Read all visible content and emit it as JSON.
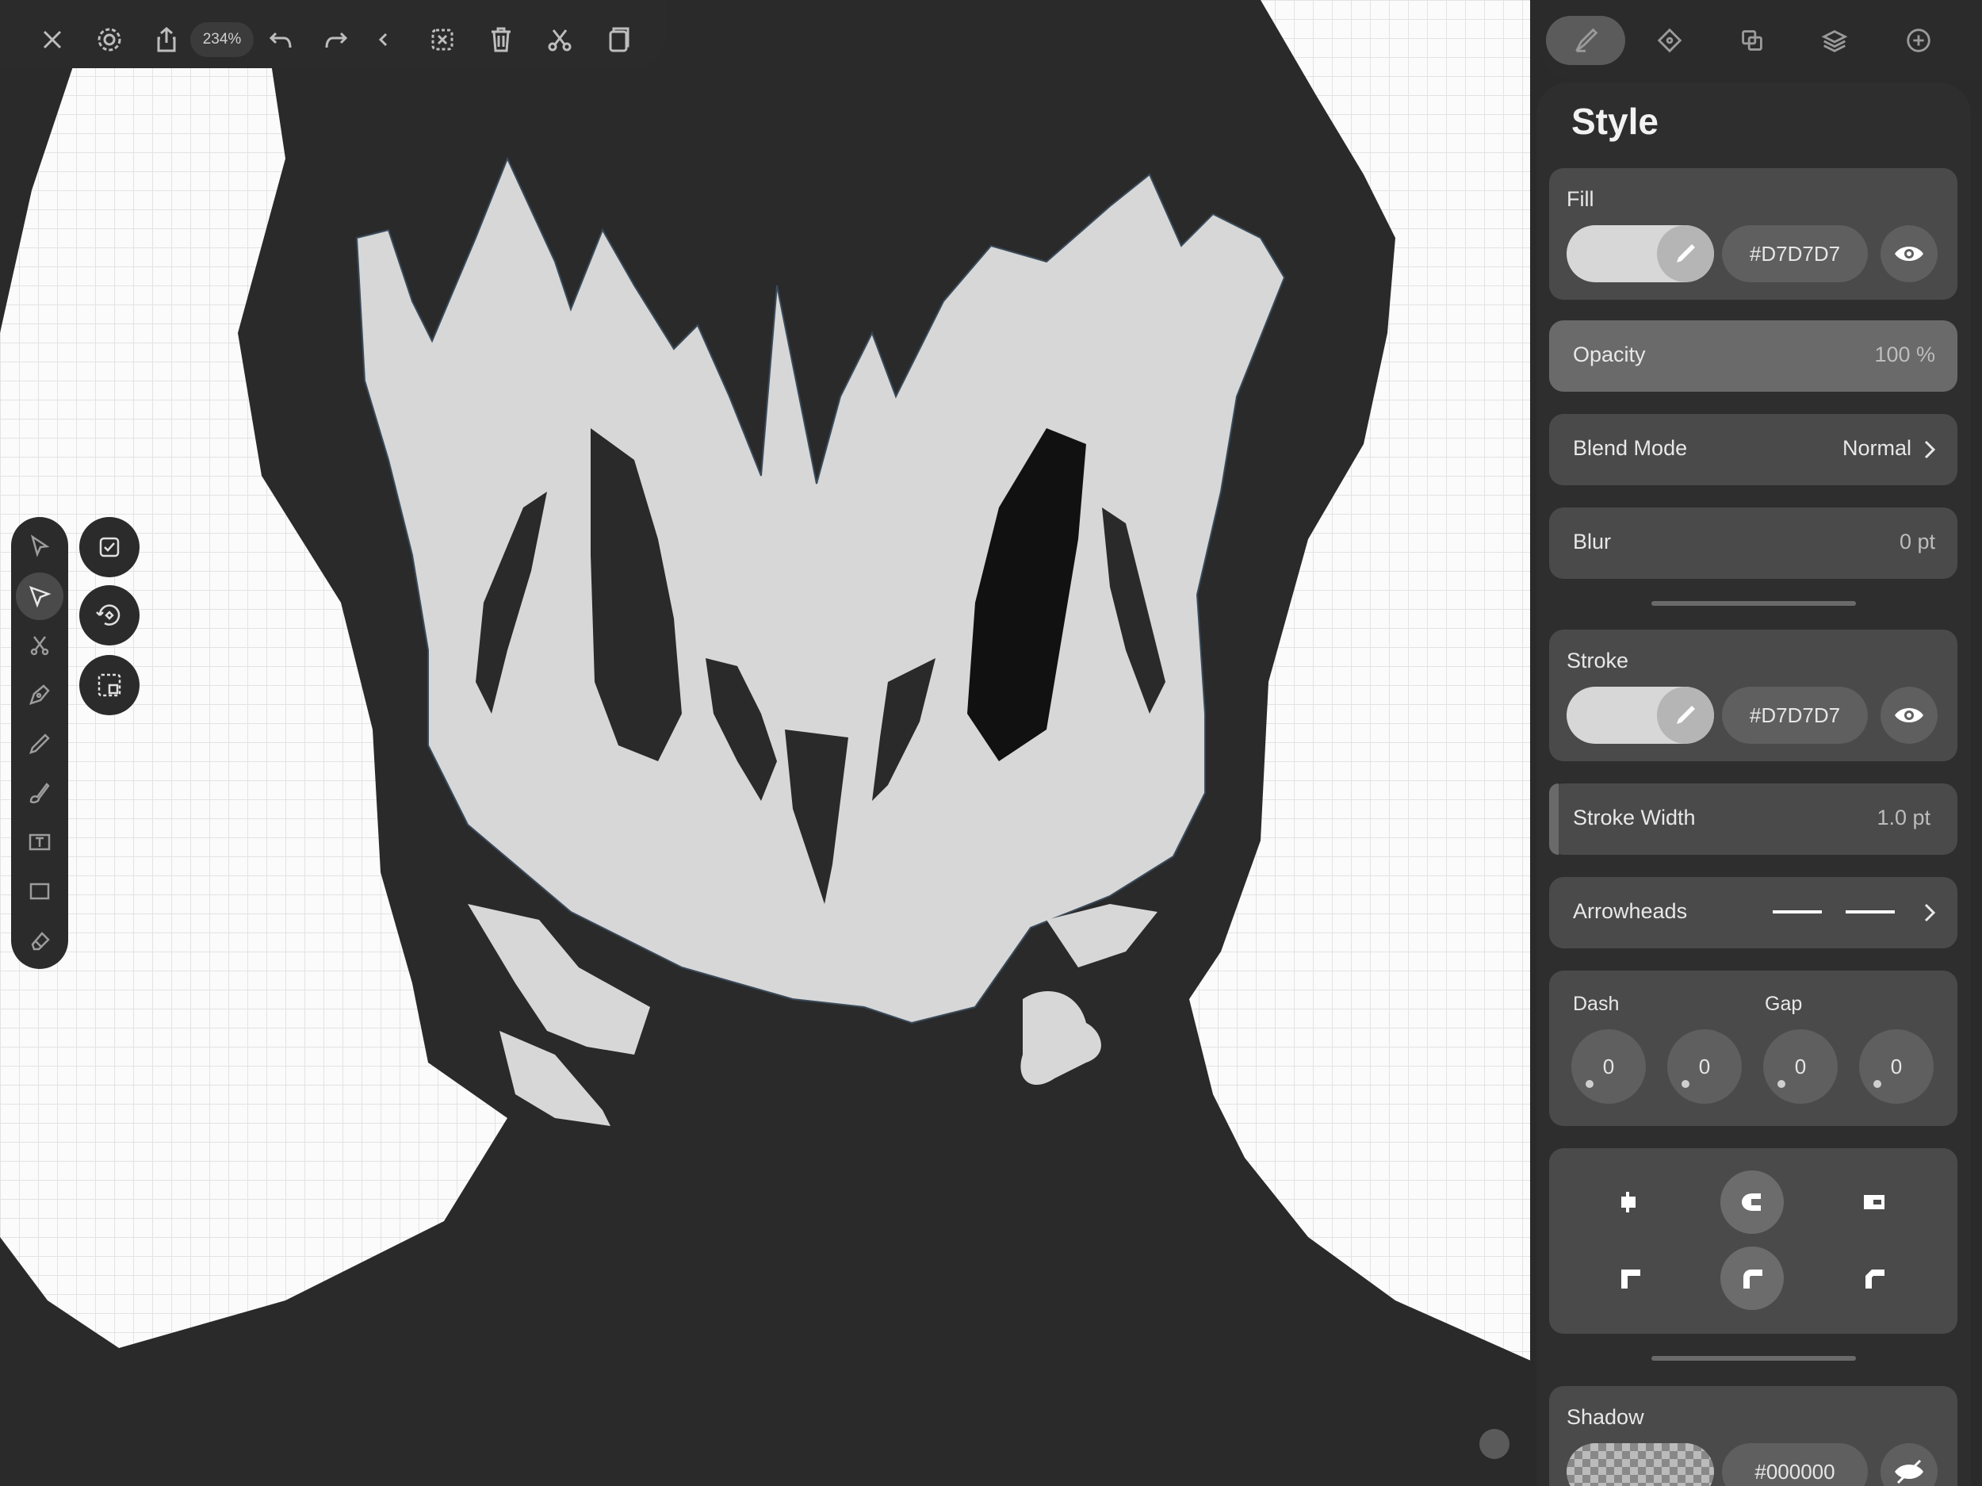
{
  "toolbar": {
    "zoom": "234%",
    "buttons": [
      "close-icon",
      "gear-icon",
      "share-icon",
      "undo-icon",
      "redo-icon",
      "chevron-left-icon",
      "deselect-icon",
      "trash-icon",
      "scissors-icon",
      "copy-icon"
    ]
  },
  "right_tabs": [
    "style-brush-icon",
    "shape-icon",
    "pathfinder-icon",
    "layers-icon",
    "add-icon"
  ],
  "style_panel": {
    "title": "Style",
    "fill": {
      "label": "Fill",
      "color": "#D7D7D7",
      "hex": "#D7D7D7"
    },
    "opacity": {
      "label": "Opacity",
      "value": "100 %"
    },
    "blend_mode": {
      "label": "Blend Mode",
      "value": "Normal"
    },
    "blur": {
      "label": "Blur",
      "value": "0 pt"
    },
    "stroke": {
      "label": "Stroke",
      "color": "#D7D7D7",
      "hex": "#D7D7D7"
    },
    "stroke_width": {
      "label": "Stroke Width",
      "value": "1.0 pt"
    },
    "arrowheads": {
      "label": "Arrowheads"
    },
    "dash": {
      "dash_label": "Dash",
      "gap_label": "Gap",
      "values": [
        "0",
        "0",
        "0",
        "0"
      ]
    },
    "shadow": {
      "label": "Shadow",
      "hex": "#000000"
    }
  },
  "colors": {
    "ui_dark": "#2b2b2b",
    "card": "#4a4a4a",
    "art_dark": "#2a2a2a",
    "art_light": "#d7d7d7"
  }
}
